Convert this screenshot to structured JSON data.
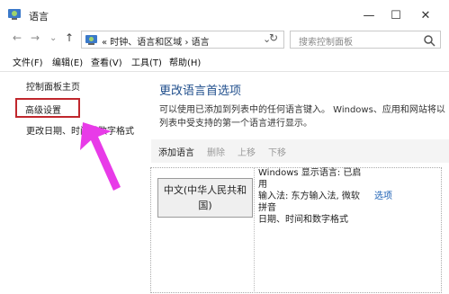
{
  "window": {
    "title": "语言"
  },
  "window_controls": {
    "minimize": "—",
    "maximize": "☐",
    "close": "✕"
  },
  "nav": {
    "back": "←",
    "forward": "→",
    "dropdown": "⌄",
    "up": "↑",
    "refresh": "↻"
  },
  "address": {
    "text": "« 时钟、语言和区域 › 语言",
    "chevron": "⌄"
  },
  "search": {
    "placeholder": "搜索控制面板"
  },
  "menu": [
    "文件(F)",
    "编辑(E)",
    "查看(V)",
    "工具(T)",
    "帮助(H)"
  ],
  "sidebar": {
    "items": [
      {
        "label": "控制面板主页"
      },
      {
        "label": "高级设置"
      },
      {
        "label": "更改日期、时间或数字格式"
      }
    ]
  },
  "main": {
    "title": "更改语言首选项",
    "description": "可以使用已添加到列表中的任何语言键入。 Windows、应用和网站将以列表中受支持的第一个语言进行显示。",
    "toolbar": [
      "添加语言",
      "删除",
      "上移",
      "下移"
    ],
    "language": {
      "name": "中文(中华人民共和国)",
      "details": [
        "Windows 显示语言: 已启用",
        "输入法: 东方输入法, 微软拼音",
        "日期、时间和数字格式"
      ],
      "options_label": "选项"
    }
  },
  "colors": {
    "accent_title": "#1f4e8c",
    "highlight_box": "#c0272d",
    "arrow": "#e83be8",
    "link": "#1a5fb4"
  },
  "icons": [
    "control-panel-icon",
    "search-icon",
    "arrow-annotation"
  ]
}
